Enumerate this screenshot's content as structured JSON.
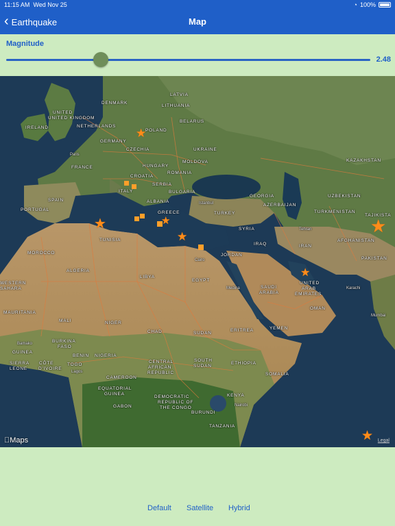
{
  "status_bar": {
    "time": "11:15 AM",
    "date": "Wed Nov 25",
    "battery": "100%"
  },
  "nav": {
    "back_label": "Earthquake",
    "title": "Map"
  },
  "magnitude": {
    "label": "Magnitude",
    "value_text": "2.48",
    "slider_fraction": 0.26
  },
  "map": {
    "attribution": "Maps",
    "legal_label": "Legal",
    "labels": {
      "latvia": "LATVIA",
      "lithuania": "LITHUANIA",
      "denmark": "DENMARK",
      "belarus": "BELARUS",
      "united_kingdom": "UNITED KINGDOM",
      "ireland": "IRELAND",
      "netherlands": "NETHERLANDS",
      "poland": "POLAND",
      "germany": "GERMANY",
      "czechia": "CZECHIA",
      "ukraine": "UKRAINE",
      "paris": "Paris",
      "france": "FRANCE",
      "hungary": "HUNGARY",
      "moldova": "MOLDOVA",
      "croatia": "CROATIA",
      "romania": "ROMANIA",
      "serbia": "SERBIA",
      "italy": "ITALY",
      "bulgaria": "BULGARIA",
      "albania": "ALBANIA",
      "kazakhstan": "KAZAKHSTAN",
      "spain": "SPAIN",
      "portugal": "PORTUGAL",
      "istanbul": "Istanbul",
      "georgia": "GEORGIA",
      "uzbekistan": "UZBEKISTAN",
      "greece": "GREECE",
      "turkey": "TURKEY",
      "azerbaijan": "AZERBAIJAN",
      "turkmenistan": "TURKMENISTAN",
      "tajikistan": "TAJIKISTA",
      "tehran": "Tehran",
      "tunisia": "TUNISIA",
      "syria": "SYRIA",
      "afghanistan": "AFGHANISTAN",
      "iraq": "IRAQ",
      "iran": "IRAN",
      "morocco": "MOROCCO",
      "cairo": "Cairo",
      "jordan": "JORDAN",
      "pakistan": "PAKISTAN",
      "algeria": "ALGERIA",
      "libya": "LIBYA",
      "egypt": "EGYPT",
      "united_arab": "UNITED",
      "arab": "ARAB",
      "emirates": "EMIRATES",
      "western": "WESTERN",
      "sahara": "SAHARA",
      "medina": "Medina",
      "saudi": "SAUDI",
      "arabia": "ARABIA",
      "karachi": "Karachi",
      "oman": "OMAN",
      "mumbai": "Mumbai",
      "mauritania": "MAURITANIA",
      "mali": "MALI",
      "niger": "NIGER",
      "chad": "CHAD",
      "sudan": "SUDAN",
      "eritrea": "ERITREA",
      "yemen": "YEMEN",
      "bamako": "Bamako",
      "burkina": "BURKINA",
      "faso": "FASO",
      "guinea": "GUINEA",
      "benin": "BENIN",
      "nigeria": "NIGERIA",
      "sierra_leone": "SIERRA",
      "leone": "LEONE",
      "cote": "CÔTE",
      "divoire": "D'IVOIRE",
      "togo": "TOGO",
      "lagos": "Lagos",
      "central": "CENTRAL",
      "african": "AFRICAN",
      "republic": "REPUBLIC",
      "south": "SOUTH",
      "sudan2": "SUDAN",
      "ethiopia": "ETHIOPIA",
      "somalia": "SOMALIA",
      "cameroon": "CAMEROON",
      "equatorial": "EQUATORIAL",
      "guinea2": "GUINEA",
      "democratic": "DEMOCRATIC",
      "republic2": "REPUBLIC OF",
      "the_congo": "THE CONGO",
      "kenya": "KENYA",
      "gabon": "GABON",
      "burundi": "BURUNDI",
      "nairobi": "Nairobi",
      "tanzania": "TANZANIA"
    }
  },
  "map_types": {
    "default": "Default",
    "satellite": "Satellite",
    "hybrid": "Hybrid"
  },
  "colors": {
    "nav_blue": "#1f5fc8",
    "panel_green": "#cdebc0",
    "marker_orange": "#ff8c1a"
  }
}
